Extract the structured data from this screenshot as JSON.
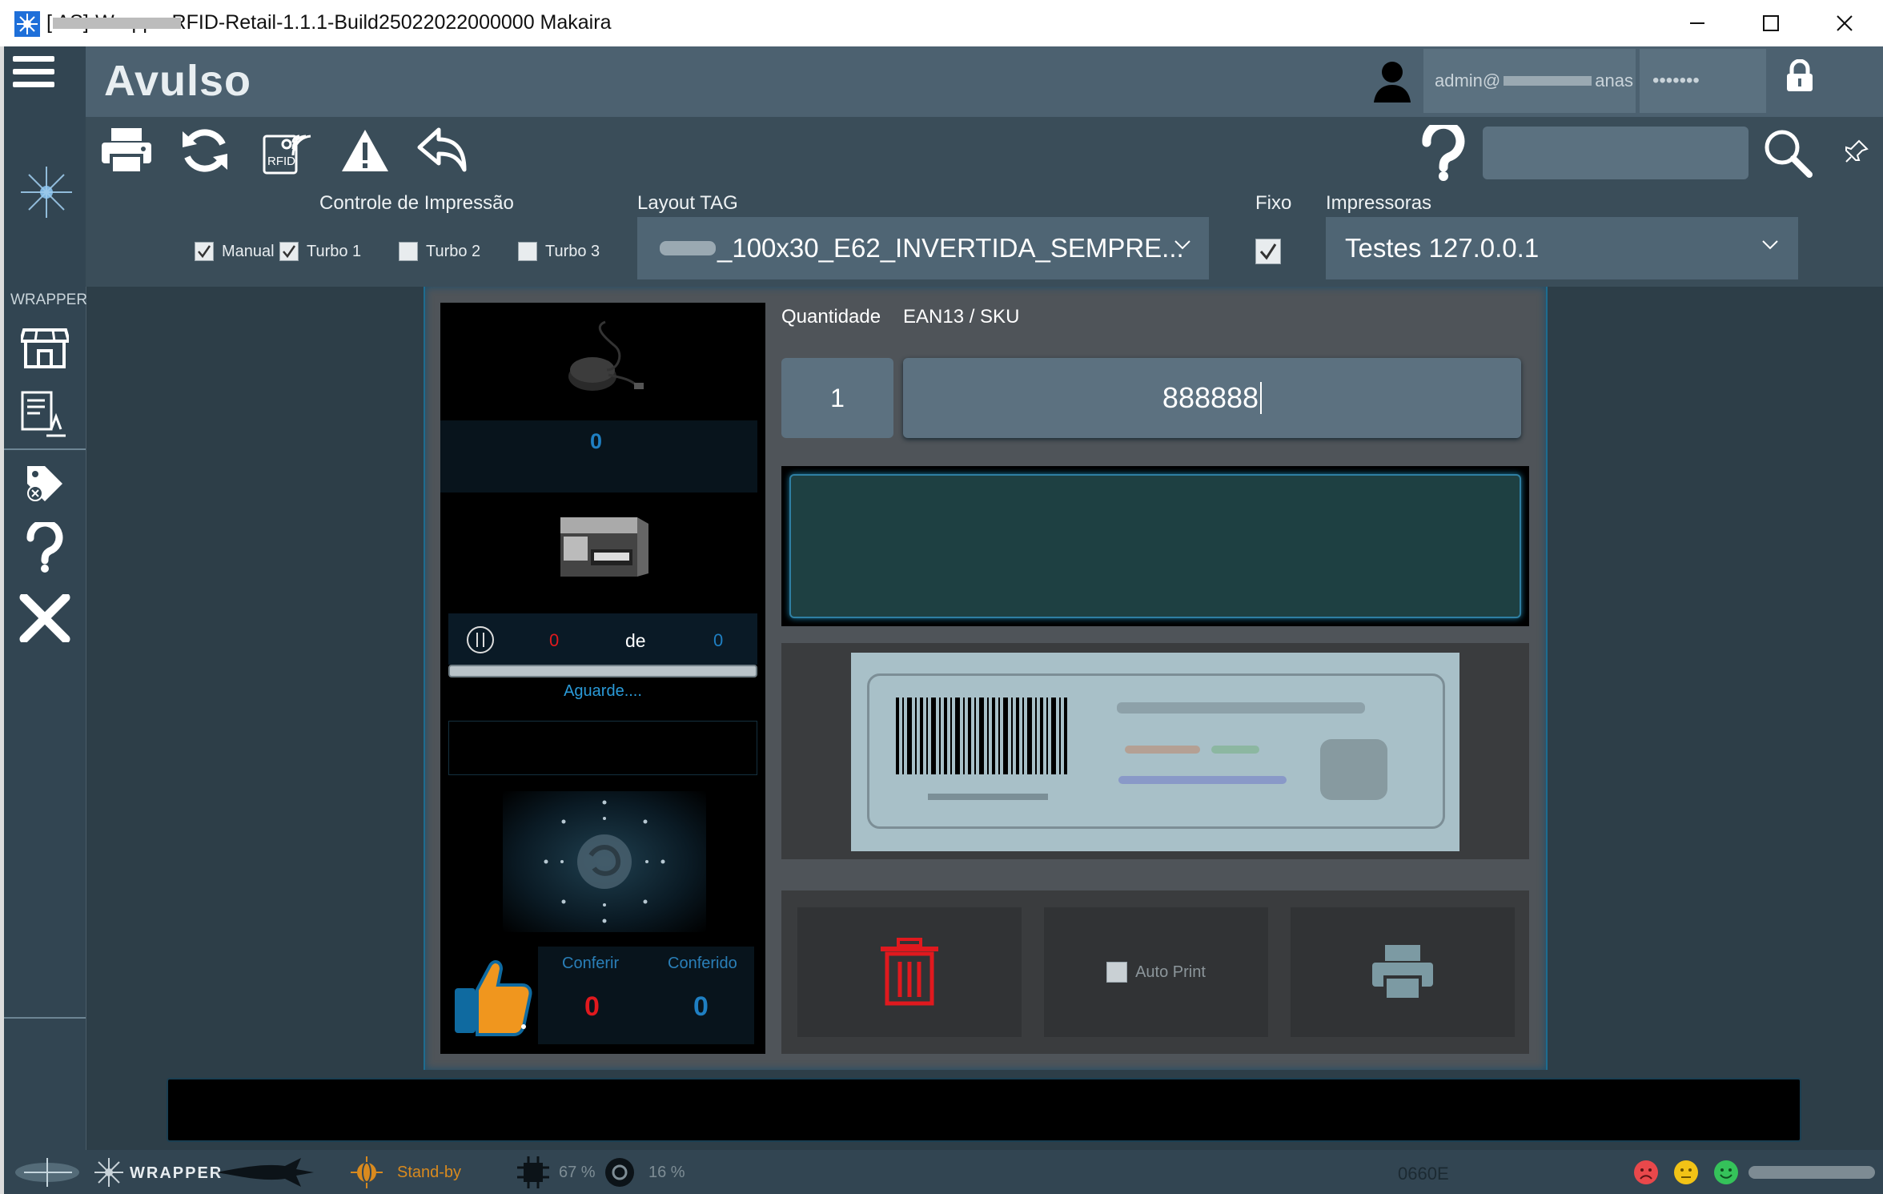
{
  "window": {
    "title": "[                    AS]-WrapperRFID-Retail-1.1.1-Build25022022000000 Makaira"
  },
  "rail": {
    "section_label": "WRAPPER"
  },
  "header": {
    "page_title": "Avulso",
    "user": "admin@",
    "user_suffix": "anas",
    "password_mask": "•••••••"
  },
  "toolbar": {
    "rfid_icon_text": "RFID",
    "help_glyph": "?",
    "search_value": ""
  },
  "controls": {
    "print_control_label": "Controle de Impressão",
    "checkboxes": [
      {
        "label": "Manual",
        "checked": true
      },
      {
        "label": "Turbo 1",
        "checked": true
      },
      {
        "label": "Turbo 2",
        "checked": false
      },
      {
        "label": "Turbo 3",
        "checked": false
      }
    ],
    "layout_label": "Layout TAG",
    "layout_value": "_100x30_E62_INVERTIDA_SEMPRE...",
    "fixo_label": "Fixo",
    "fixo_checked": true,
    "printers_label": "Impressoras",
    "printers_value": "Testes 127.0.0.1"
  },
  "left_panel": {
    "reader_count": "0",
    "printed": "0",
    "of_label": "de",
    "total": "0",
    "progress": 0,
    "status": "Aguarde....",
    "check_label": "Conferir",
    "checked_label": "Conferido",
    "check_value": "0",
    "checked_value": "0"
  },
  "form": {
    "quantity_label": "Quantidade",
    "sku_label": "EAN13 / SKU",
    "quantity_value": "1",
    "sku_value": "888888"
  },
  "actions": {
    "auto_print_label": "Auto Print",
    "auto_print_checked": false
  },
  "statusbar": {
    "brand": "WRAPPER",
    "state": "Stand-by",
    "cpu": "67 %",
    "disk": "16 %",
    "code": "0660E"
  },
  "colors": {
    "accent_blue": "#1f7fc2",
    "danger_red": "#e0191e",
    "standby_orange": "#d98a1e"
  }
}
